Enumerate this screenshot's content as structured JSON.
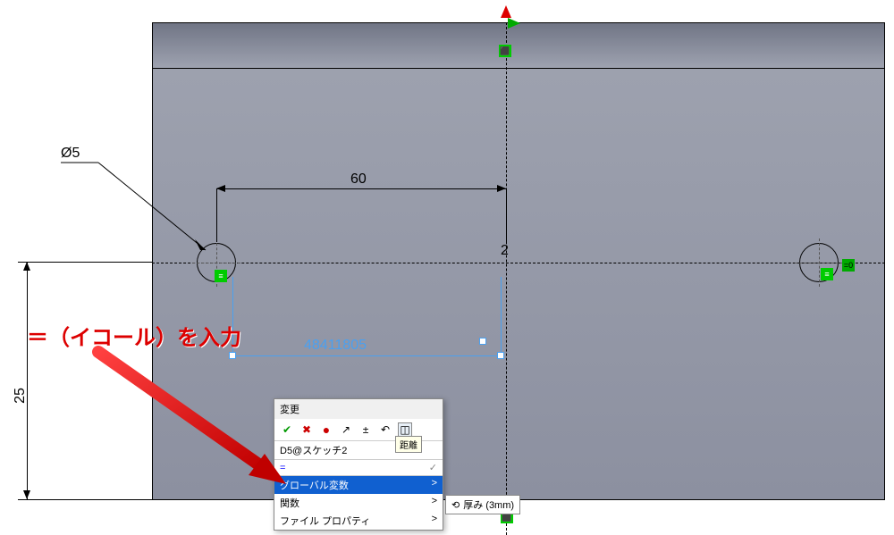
{
  "annotation_text": "＝（イコール）を入力",
  "dimensions": {
    "diameter_label": "Ø5",
    "horizontal_value": "60",
    "dim2_value": "2",
    "vertical_value": "25"
  },
  "sketch_dim_ghost": "48411805",
  "modify_dialog": {
    "title": "変更",
    "field_name": "D5@スケッチ2",
    "input_value": "=",
    "tooltip": "距離",
    "dropdown": {
      "selected": "グローバル変数",
      "functions": "関数",
      "file_props": "ファイル プロパティ",
      "arrow": ">"
    }
  },
  "flyout": {
    "label": "厚み (3mm)",
    "icon": "⟲"
  },
  "icons": {
    "ok": "✔",
    "cancel": "✖",
    "stoplight": "●",
    "arrow_up": "↗",
    "plus_minus": "±",
    "undo": "↶",
    "ruler": "◫",
    "inputcheck": "✓"
  }
}
